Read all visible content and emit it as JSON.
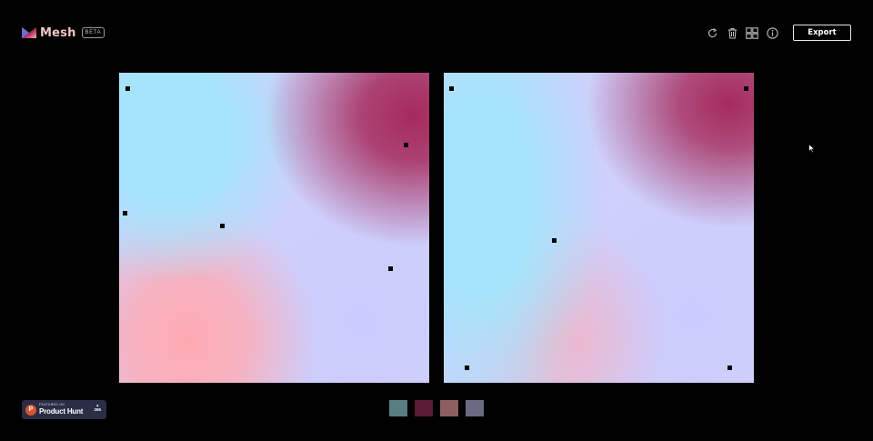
{
  "header": {
    "app_name": "Mesh",
    "beta_label": "BETA",
    "export_label": "Export",
    "tools": [
      "refresh-icon",
      "trash-icon",
      "grid-icon",
      "info-icon"
    ]
  },
  "colors": {
    "sky_blue": "#a6e4fb",
    "crimson": "#a52a5c",
    "pink": "#ffaab2",
    "lavender": "#cbcbfe",
    "page_background": "#000000"
  },
  "swatches": [
    "#5a7c83",
    "#5a1a36",
    "#8c5e62",
    "#6a6a83"
  ],
  "product_hunt": {
    "small_label": "FEATURED ON",
    "name": "Product Hunt",
    "arrow": "▲",
    "votes": "286"
  }
}
